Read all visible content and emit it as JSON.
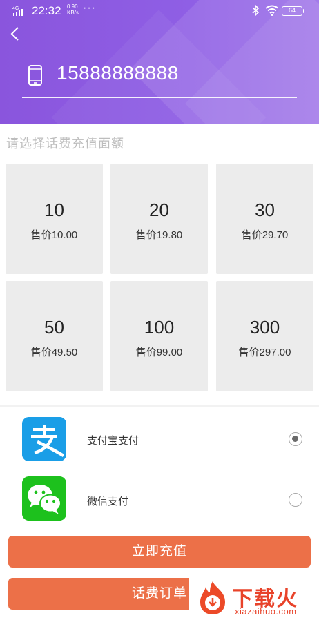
{
  "status_bar": {
    "network": "4G",
    "time": "22:32",
    "speed_value": "0.90",
    "speed_unit": "KB/s",
    "dots": "···",
    "battery": "64"
  },
  "header": {
    "phone_number": "15888888888"
  },
  "section": {
    "title": "请选择话费充值面额"
  },
  "options": [
    {
      "amount": "10",
      "price": "售价10.00"
    },
    {
      "amount": "20",
      "price": "售价19.80"
    },
    {
      "amount": "30",
      "price": "售价29.70"
    },
    {
      "amount": "50",
      "price": "售价49.50"
    },
    {
      "amount": "100",
      "price": "售价99.00"
    },
    {
      "amount": "300",
      "price": "售价297.00"
    }
  ],
  "payment": [
    {
      "label": "支付宝支付",
      "icon": "alipay-icon",
      "selected": true
    },
    {
      "label": "微信支付",
      "icon": "wechat-icon",
      "selected": false
    }
  ],
  "buttons": {
    "recharge": "立即充值",
    "orders": "话费订单"
  },
  "watermark": {
    "brand": "下载火",
    "url": "xiazaihuo.com"
  },
  "colors": {
    "header_purple": "#8f5fe5",
    "button_orange": "#ec7048",
    "alipay_blue": "#1a9ee7",
    "wechat_green": "#1dc11d"
  }
}
